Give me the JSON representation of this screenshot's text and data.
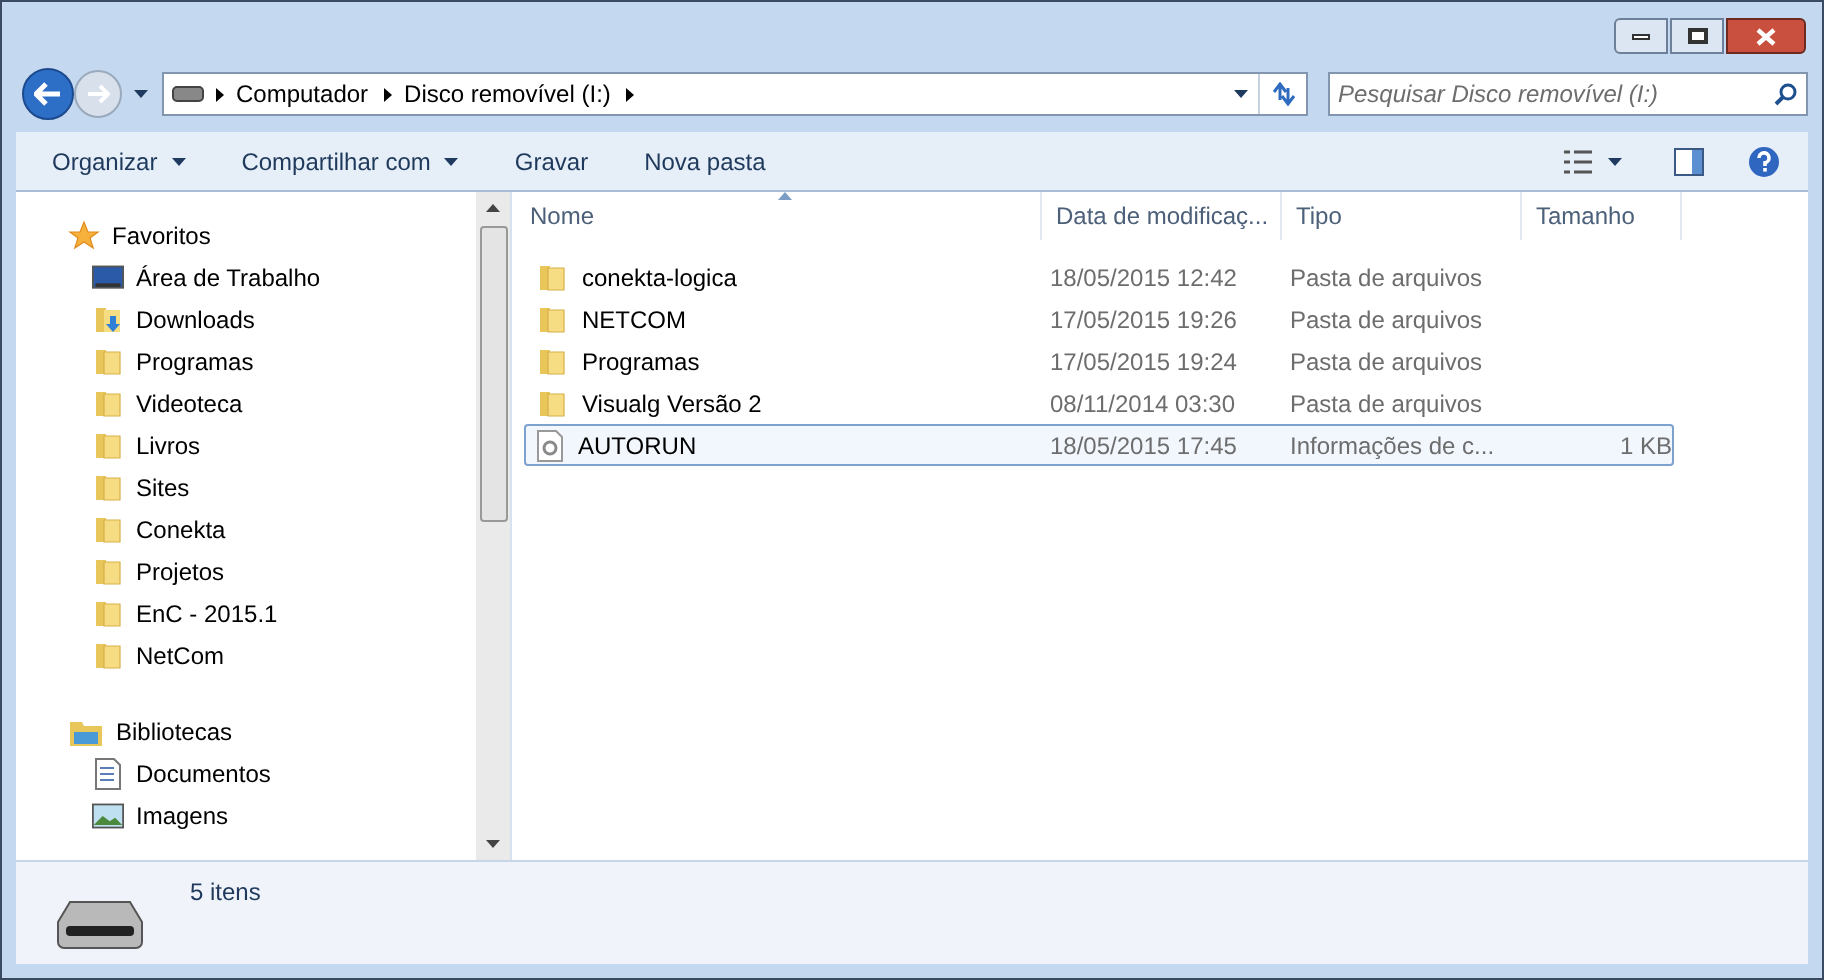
{
  "address": {
    "crumbs": [
      "Computador",
      "Disco removível (I:)"
    ]
  },
  "search": {
    "placeholder": "Pesquisar Disco removível (I:)"
  },
  "toolbar": [
    {
      "label": "Organizar",
      "dropdown": true
    },
    {
      "label": "Compartilhar com",
      "dropdown": true
    },
    {
      "label": "Gravar",
      "dropdown": false
    },
    {
      "label": "Nova pasta",
      "dropdown": false
    }
  ],
  "nav": [
    {
      "label": "Favoritos",
      "kind": "favorites",
      "children": [
        {
          "label": "Área de Trabalho",
          "kind": "desktop"
        },
        {
          "label": "Downloads",
          "kind": "downloads"
        },
        {
          "label": "Programas",
          "kind": "folder"
        },
        {
          "label": "Videoteca",
          "kind": "folder"
        },
        {
          "label": "Livros",
          "kind": "folder"
        },
        {
          "label": "Sites",
          "kind": "folder"
        },
        {
          "label": "Conekta",
          "kind": "folder"
        },
        {
          "label": "Projetos",
          "kind": "folder"
        },
        {
          "label": "EnC - 2015.1",
          "kind": "folder"
        },
        {
          "label": "NetCom",
          "kind": "folder"
        }
      ]
    },
    {
      "label": "Bibliotecas",
      "kind": "libraries",
      "children": [
        {
          "label": "Documentos",
          "kind": "documents"
        },
        {
          "label": "Imagens",
          "kind": "images"
        }
      ]
    }
  ],
  "table": {
    "columns": [
      {
        "label": "Nome",
        "sorted": true
      },
      {
        "label": "Data de modificaç...",
        "sorted": false
      },
      {
        "label": "Tipo",
        "sorted": false
      },
      {
        "label": "Tamanho",
        "sorted": false
      }
    ],
    "rows": [
      {
        "kind": "folder",
        "name": "conekta-logica",
        "date": "18/05/2015 12:42",
        "type": "Pasta de arquivos",
        "selected": false
      },
      {
        "kind": "folder",
        "name": "NETCOM",
        "date": "17/05/2015 19:26",
        "type": "Pasta de arquivos",
        "selected": false
      },
      {
        "kind": "folder",
        "name": "Programas",
        "date": "17/05/2015 19:24",
        "type": "Pasta de arquivos",
        "selected": false
      },
      {
        "kind": "folder",
        "name": "Visualg Versão 2",
        "date": "08/11/2014 03:30",
        "type": "Pasta de arquivos",
        "selected": false
      },
      {
        "kind": "settings-file",
        "name": "AUTORUN",
        "date": "18/05/2015 17:45",
        "type": "Informações de c...",
        "size": "1 KB",
        "selected": true
      }
    ]
  },
  "status_bar": {
    "count": "5 itens"
  }
}
